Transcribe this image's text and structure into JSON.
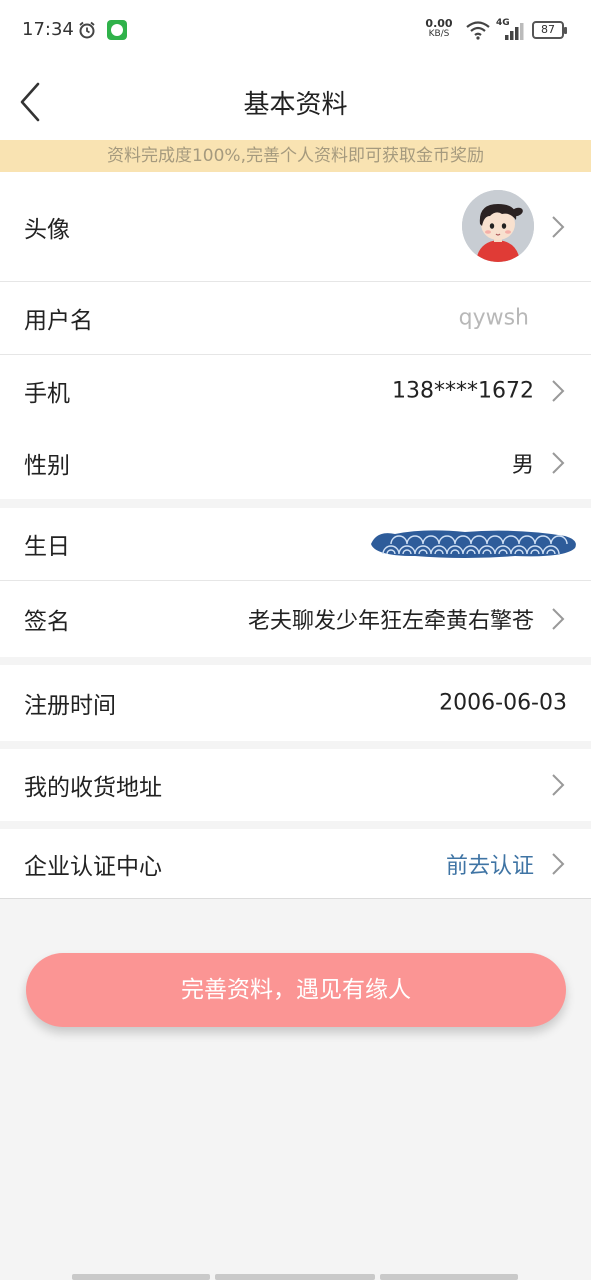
{
  "status_bar": {
    "time": "17:34",
    "net_speed_value": "0.00",
    "net_speed_unit": "KB/S",
    "network_type": "4G",
    "battery": "87",
    "icons": [
      "alarm-icon",
      "app-notification-icon",
      "wifi-icon",
      "signal-icon",
      "battery-icon"
    ]
  },
  "header": {
    "title": "基本资料",
    "back_icon": "chevron-left-icon"
  },
  "banner": {
    "text": "资料完成度100%,完善个人资料即可获取金币奖励"
  },
  "rows": {
    "avatar": {
      "label": "头像"
    },
    "username": {
      "label": "用户名",
      "value": "qywsh"
    },
    "phone": {
      "label": "手机",
      "value": "138****1672"
    },
    "gender": {
      "label": "性别",
      "value": "男"
    },
    "birthday": {
      "label": "生日"
    },
    "signature": {
      "label": "签名",
      "value": "老夫聊发少年狂左牵黄右擎苍"
    },
    "register_time": {
      "label": "注册时间",
      "value": "2006-06-03"
    },
    "address": {
      "label": "我的收货地址"
    },
    "enterprise": {
      "label": "企业认证中心",
      "value": "前去认证"
    }
  },
  "cta": {
    "label": "完善资料，遇见有缘人"
  },
  "colors": {
    "banner_bg": "#f9e3b2",
    "banner_text": "#a59a7e",
    "cta_bg": "#fb9594",
    "link_blue": "#3f74a4",
    "placeholder_grey": "#b8b8b8",
    "page_bg": "#f4f4f4"
  }
}
